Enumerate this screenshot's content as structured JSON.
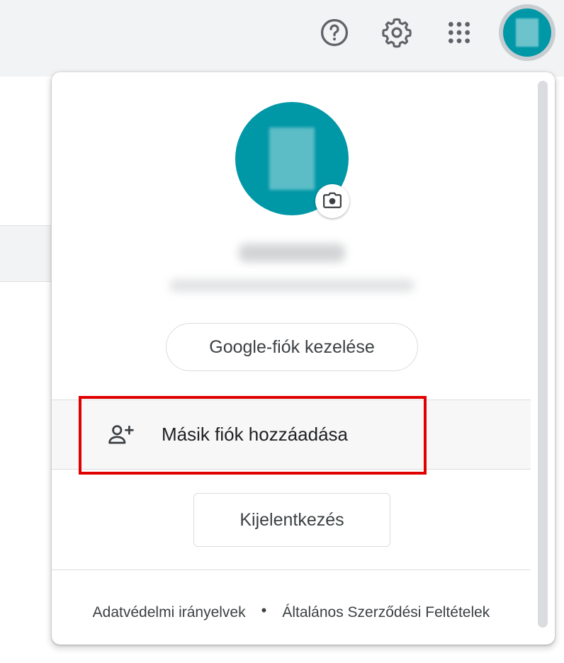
{
  "header": {
    "icons": [
      "help-icon",
      "gear-icon",
      "apps-icon"
    ],
    "avatar": "account-avatar"
  },
  "account_menu": {
    "manage_account": "Google-fiók kezelése",
    "add_account": "Másik fiók hozzáadása",
    "sign_out": "Kijelentkezés",
    "footer": {
      "privacy": "Adatvédelmi irányelvek",
      "separator": "•",
      "terms": "Általános Szerződési Feltételek"
    }
  },
  "colors": {
    "accent": "#0097a7",
    "highlight": "#e00000",
    "text": "#3c4043",
    "topbar_bg": "#f1f3f4"
  }
}
